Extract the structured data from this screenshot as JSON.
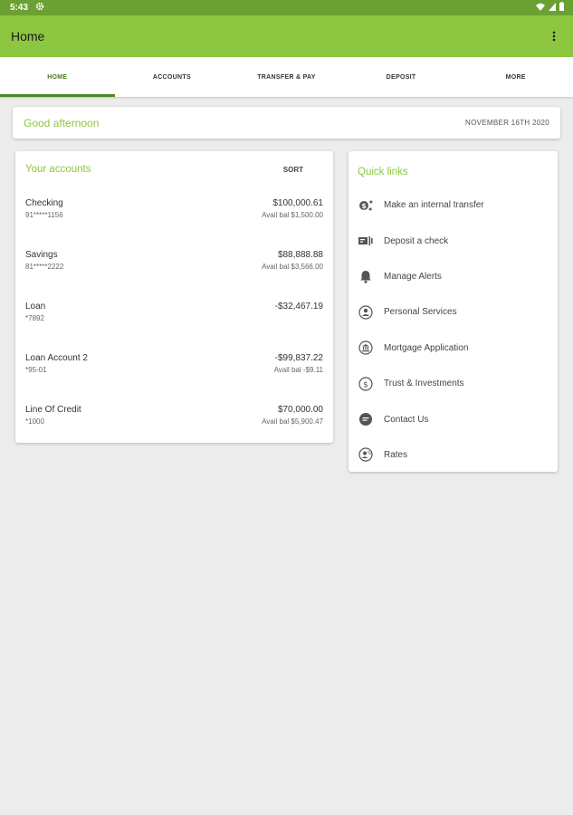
{
  "status_bar": {
    "time": "5:43",
    "icons": [
      "gear-icon",
      "wifi-icon",
      "signal-icon",
      "battery-icon"
    ]
  },
  "app_bar": {
    "title": "Home",
    "menu_icon": "more-vert-icon"
  },
  "tabs": [
    {
      "label": "HOME",
      "active": true
    },
    {
      "label": "ACCOUNTS",
      "active": false
    },
    {
      "label": "TRANSFER & PAY",
      "active": false
    },
    {
      "label": "DEPOSIT",
      "active": false
    },
    {
      "label": "MORE",
      "active": false
    }
  ],
  "greeting": {
    "text": "Good afternoon",
    "date": "NOVEMBER 16TH 2020"
  },
  "accounts": {
    "title": "Your accounts",
    "sort_label": "SORT",
    "items": [
      {
        "name": "Checking",
        "number": "91*****1156",
        "balance": "$100,000.61",
        "avail": "Avail bal $1,500.00"
      },
      {
        "name": "Savings",
        "number": "81*****2222",
        "balance": "$88,888.88",
        "avail": "Avail bal $3,566.00"
      },
      {
        "name": "Loan",
        "number": "*7892",
        "balance": "-$32,467.19",
        "avail": ""
      },
      {
        "name": "Loan Account 2",
        "number": "*95-01",
        "balance": "-$99,837.22",
        "avail": "Avail bal -$9.11"
      },
      {
        "name": "Line Of Credit",
        "number": "*1000",
        "balance": "$70,000.00",
        "avail": "Avail bal $5,900.47"
      }
    ]
  },
  "quick_links": {
    "title": "Quick links",
    "items": [
      {
        "label": "Make an internal transfer",
        "icon": "transfer-icon"
      },
      {
        "label": "Deposit a check",
        "icon": "check-deposit-icon"
      },
      {
        "label": "Manage Alerts",
        "icon": "bell-icon"
      },
      {
        "label": "Personal Services",
        "icon": "person-icon"
      },
      {
        "label": "Mortgage Application",
        "icon": "bank-icon"
      },
      {
        "label": "Trust & Investments",
        "icon": "dollar-icon"
      },
      {
        "label": "Contact Us",
        "icon": "chat-icon"
      },
      {
        "label": "Rates",
        "icon": "rates-icon"
      }
    ]
  },
  "colors": {
    "status_bar": "#6ba032",
    "app_bar": "#8dc63f",
    "accent": "#8dc63f",
    "active_tab": "#4a8a22",
    "background": "#ececec"
  }
}
